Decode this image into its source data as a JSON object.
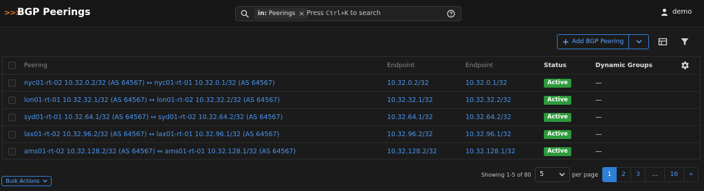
{
  "header": {
    "logo_glyph": ">>>",
    "title": "BGP Peerings",
    "search": {
      "chip_prefix": "in:",
      "chip_value": "Peerings",
      "chip_remove": "×",
      "placeholder_pre": "Press ",
      "placeholder_kbd": "Ctrl+K",
      "placeholder_post": " to search"
    },
    "user": "demo"
  },
  "toolbar": {
    "add_label": "Add BGP Peering",
    "add_icon": "plus-icon",
    "icons": [
      "table-config-icon",
      "filter-icon"
    ]
  },
  "table": {
    "headers": {
      "peering": "Peering",
      "endpoint_a": "Endpoint",
      "endpoint_b": "Endpoint",
      "status": "Status",
      "dynamic_groups": "Dynamic Groups"
    },
    "rows": [
      {
        "peering": "nyc01-rt-02 10.32.0.2/32 (AS 64567) ↔ nyc01-rt-01 10.32.0.1/32 (AS 64567)",
        "endpoint_a": "10.32.0.2/32",
        "endpoint_b": "10.32.0.1/32",
        "status": "Active",
        "dynamic_groups": "—"
      },
      {
        "peering": "lon01-rt-01 10.32.32.1/32 (AS 64567) ↔ lon01-rt-02 10.32.32.2/32 (AS 64567)",
        "endpoint_a": "10.32.32.1/32",
        "endpoint_b": "10.32.32.2/32",
        "status": "Active",
        "dynamic_groups": "—"
      },
      {
        "peering": "syd01-rt-01 10.32.64.1/32 (AS 64567) ↔ syd01-rt-02 10.32.64.2/32 (AS 64567)",
        "endpoint_a": "10.32.64.1/32",
        "endpoint_b": "10.32.64.2/32",
        "status": "Active",
        "dynamic_groups": "—"
      },
      {
        "peering": "lax01-rt-02 10.32.96.2/32 (AS 64567) ↔ lax01-rt-01 10.32.96.1/32 (AS 64567)",
        "endpoint_a": "10.32.96.2/32",
        "endpoint_b": "10.32.96.1/32",
        "status": "Active",
        "dynamic_groups": "—"
      },
      {
        "peering": "ams01-rt-02 10.32.128.2/32 (AS 64567) ↔ ams01-rt-01 10.32.128.1/32 (AS 64567)",
        "endpoint_a": "10.32.128.2/32",
        "endpoint_b": "10.32.128.1/32",
        "status": "Active",
        "dynamic_groups": "—"
      }
    ]
  },
  "footer": {
    "showing": "Showing 1-5 of 80",
    "per_page_value": "5",
    "per_page_label": "per page",
    "pages": [
      "1",
      "2",
      "3",
      "…",
      "16",
      "»"
    ],
    "active_page": "1",
    "bulk_actions": "Bulk Actions"
  },
  "colors": {
    "accent": "#2f7fd6",
    "link": "#4a96f0",
    "status_active": "#2f9a3d",
    "logo": "#e8742a"
  }
}
